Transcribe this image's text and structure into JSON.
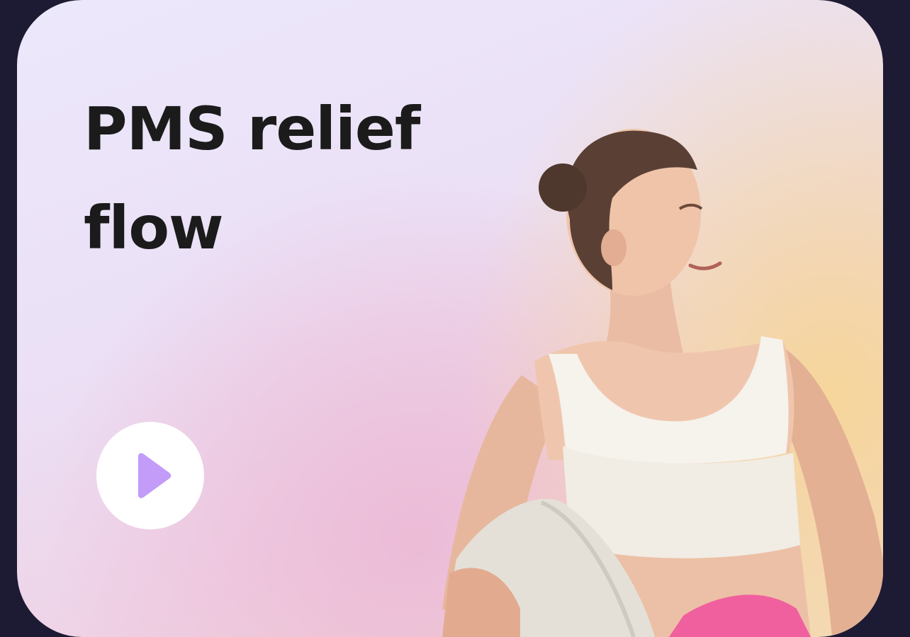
{
  "card": {
    "title": "PMS relief flow",
    "play_button": {
      "icon": "play-icon",
      "color": "#c29cf8"
    },
    "photo": {
      "subject": "woman-with-yoga-mat",
      "accent_mat_color": "#f0609e"
    }
  },
  "colors": {
    "page_background": "#1d1a33",
    "title_text": "#1b1b1b",
    "gradient_lavender": "#ece8fb",
    "gradient_pink": "#efc6df",
    "gradient_peach": "#f6d696"
  }
}
